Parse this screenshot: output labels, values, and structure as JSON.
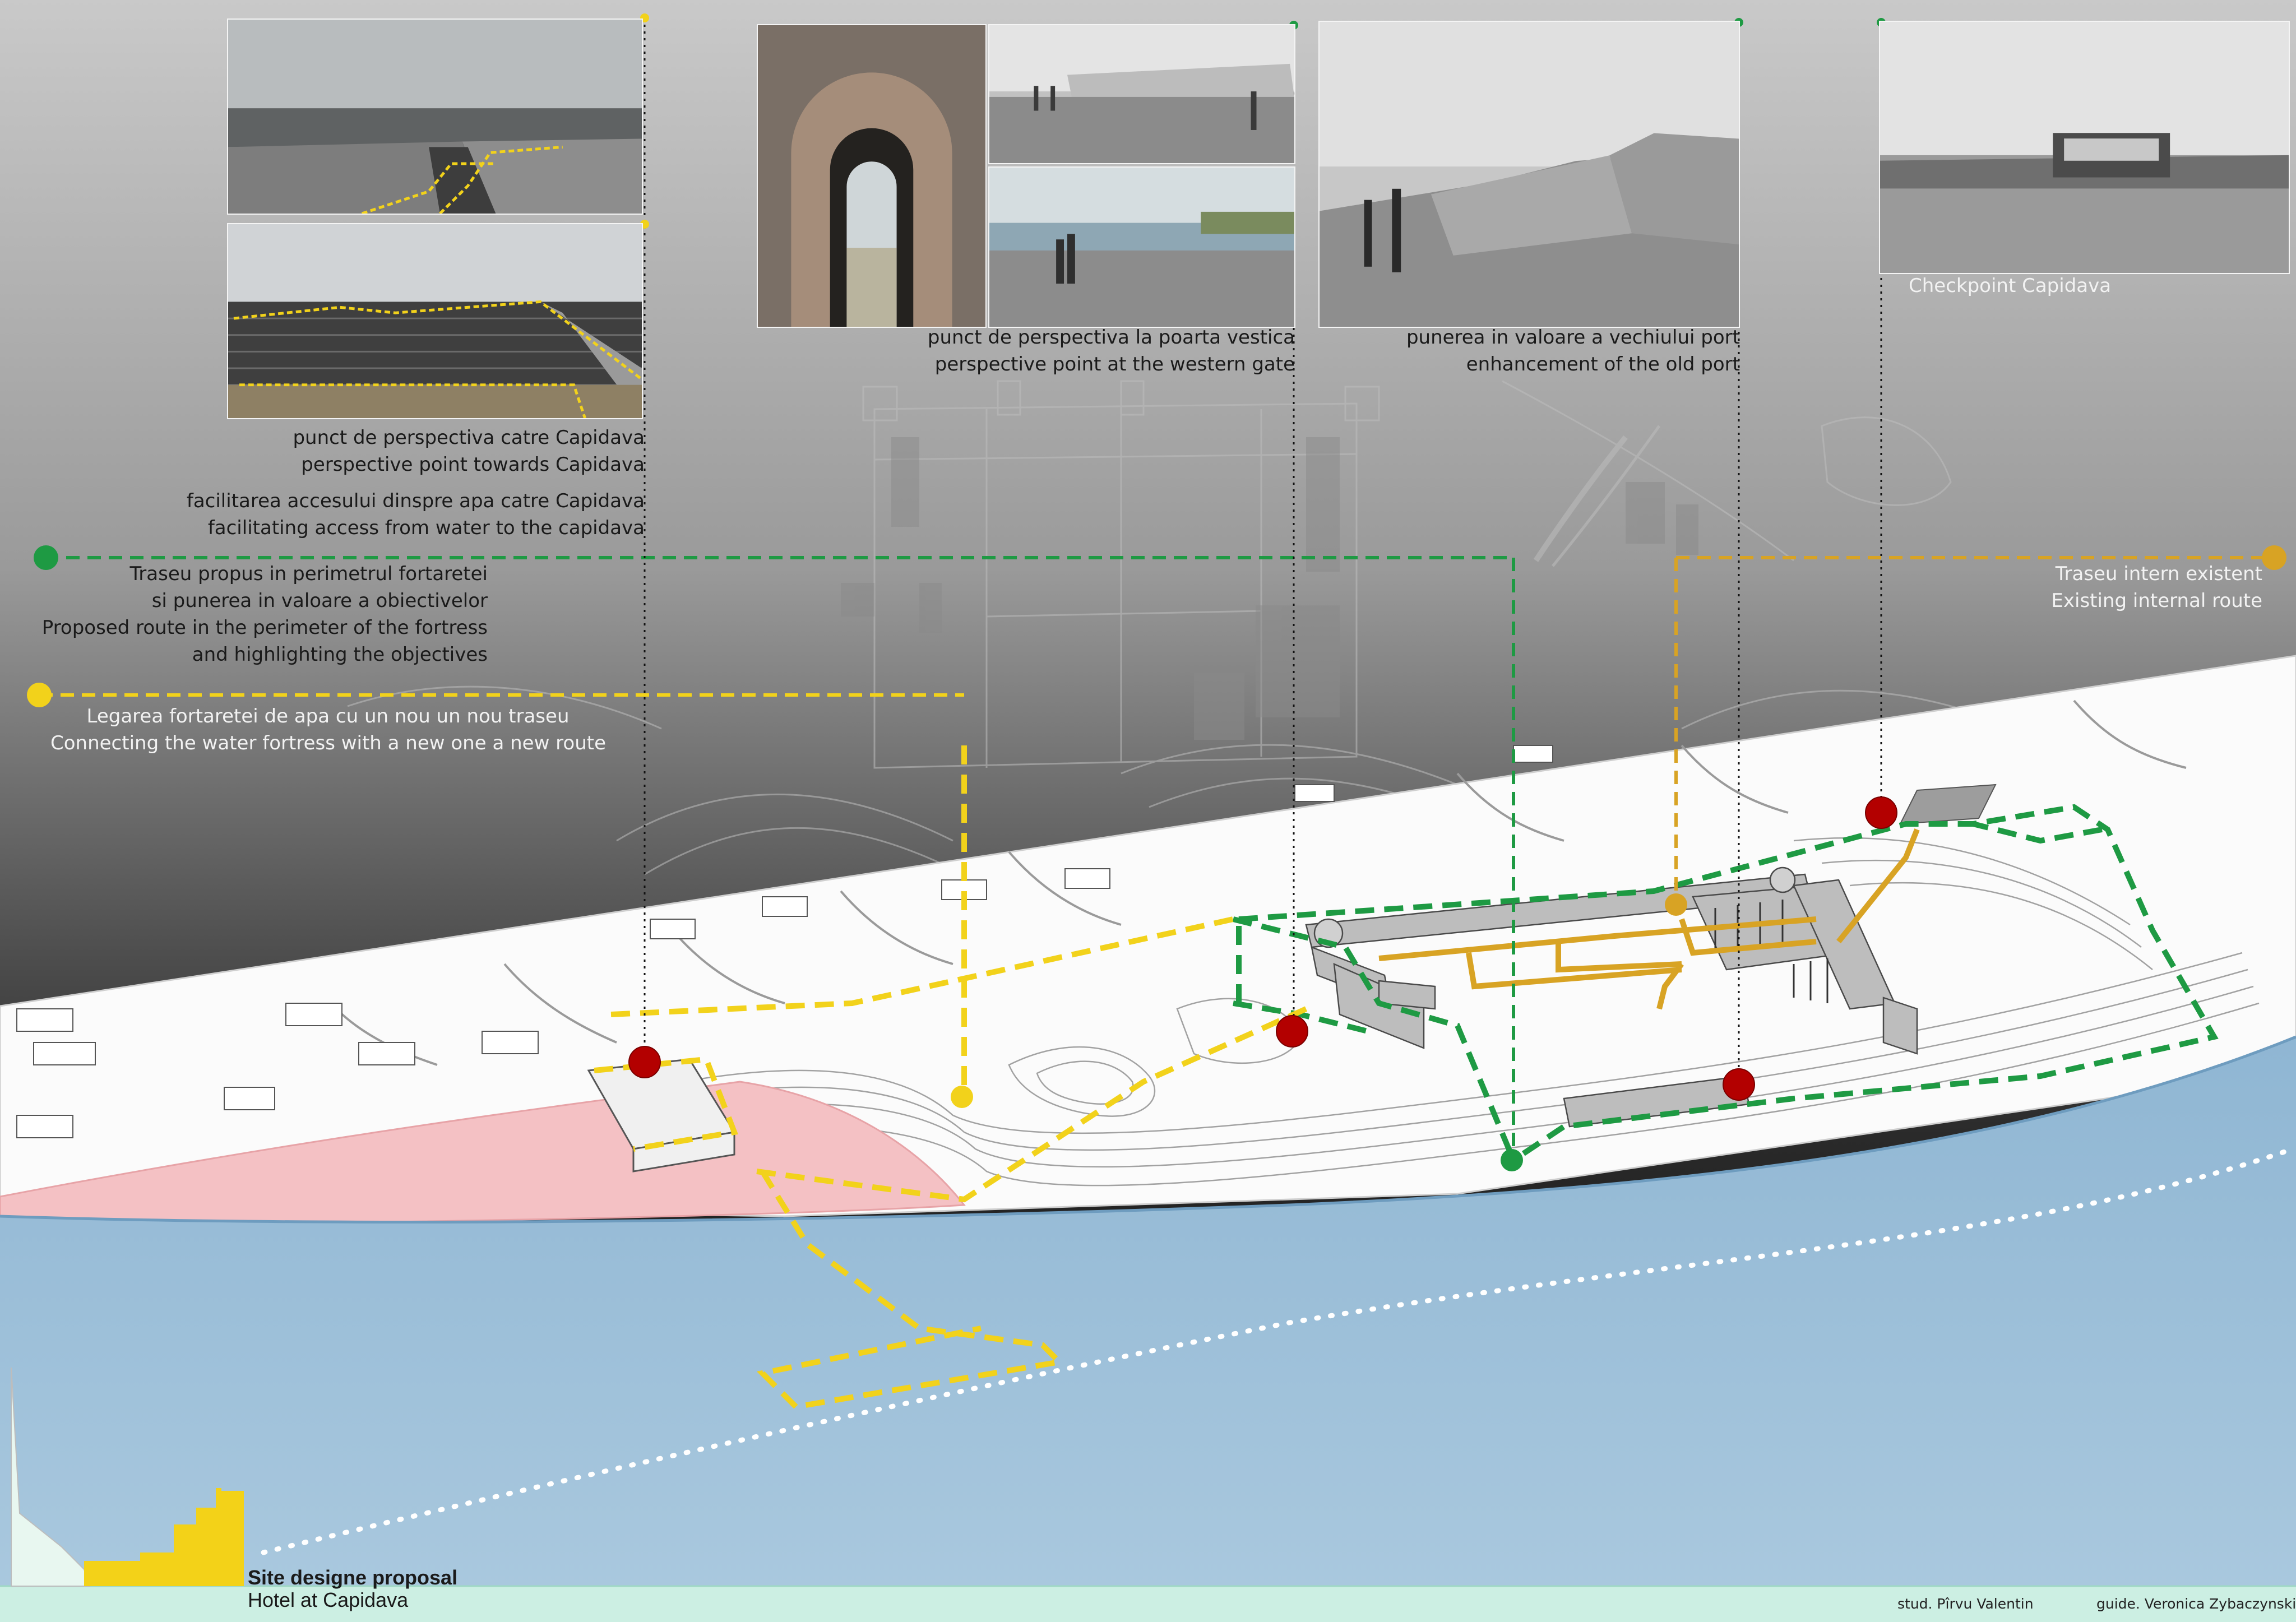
{
  "captions": {
    "perspective_capidava_ro": "punct de perspectiva catre Capidava",
    "perspective_capidava_en": "perspective point towards Capidava",
    "water_access_ro": "facilitarea accesului dinspre apa catre Capidava",
    "water_access_en": "facilitating access from  water to the capidava",
    "western_gate_ro": "punct de perspectiva la poarta vestica",
    "western_gate_en": "perspective point at the western gate",
    "old_port_ro": "punerea in valoare a vechiului port",
    "old_port_en": "enhancement of the old port",
    "checkpoint": "Checkpoint Capidava"
  },
  "legend": {
    "green_route": {
      "lines": [
        "Traseu propus in perimetrul fortaretei",
        "si punerea in valoare a obiectivelor",
        "Proposed route in the perimeter of the fortress",
        "and highlighting the objectives"
      ],
      "color": "#1e9a43"
    },
    "yellow_route": {
      "lines": [
        "Legarea fortaretei  de apa cu un nou un nou traseu",
        "Connecting the water fortress with a new one a new route"
      ],
      "color": "#f2d21b"
    },
    "internal_route": {
      "lines": [
        "Traseu intern existent",
        "Existing internal route"
      ],
      "color": "#d8a324"
    }
  },
  "colors": {
    "marker_red": "#b30000",
    "water": "#a9c9e0",
    "shore_pink": "#f4c1c4",
    "footer_mint": "#ccefe3",
    "silhouette_yellow": "#f3d218"
  },
  "title": {
    "main": "Site designe proposal",
    "sub": "Hotel at Capidava"
  },
  "credits": {
    "student": "stud. Pîrvu Valentin",
    "guide": "guide. Veronica Zybaczynski"
  }
}
